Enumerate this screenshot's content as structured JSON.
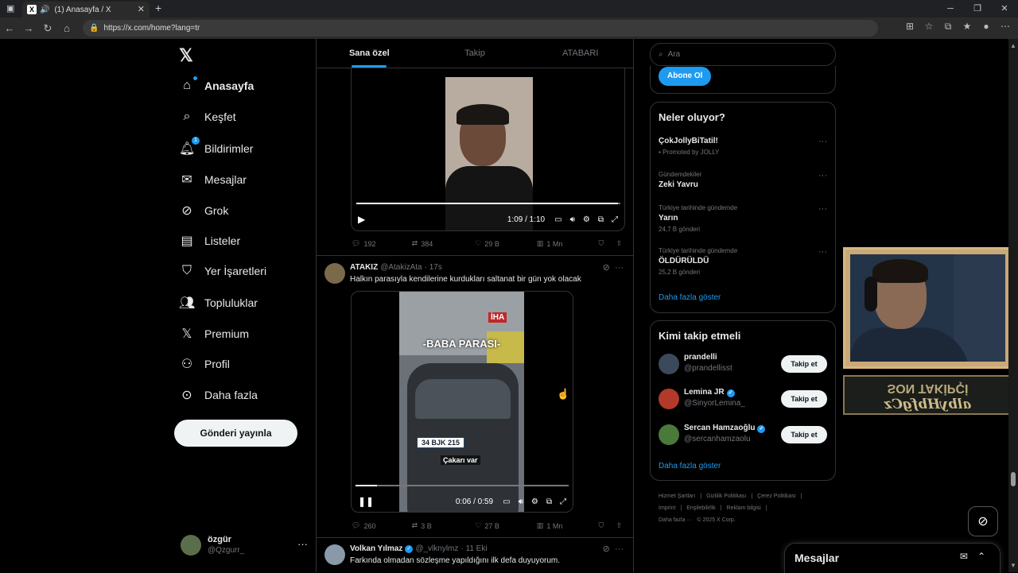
{
  "browser": {
    "tab_title": "(1) Anasayfa / X",
    "url": "https://x.com/home?lang=tr"
  },
  "nav": {
    "items": [
      {
        "label": "Anasayfa",
        "icon": "home-icon"
      },
      {
        "label": "Keşfet",
        "icon": "search-icon"
      },
      {
        "label": "Bildirimler",
        "icon": "bell-icon",
        "badge": "1"
      },
      {
        "label": "Mesajlar",
        "icon": "mail-icon"
      },
      {
        "label": "Grok",
        "icon": "grok-icon"
      },
      {
        "label": "Listeler",
        "icon": "list-icon"
      },
      {
        "label": "Yer İşaretleri",
        "icon": "bookmark-icon"
      },
      {
        "label": "Topluluklar",
        "icon": "communities-icon"
      },
      {
        "label": "Premium",
        "icon": "x-icon"
      },
      {
        "label": "Profil",
        "icon": "person-icon"
      },
      {
        "label": "Daha fazla",
        "icon": "more-circle-icon"
      }
    ],
    "post_button": "Gönderi yayınla",
    "account": {
      "name": "özgür",
      "handle": "@Qzgurr_"
    }
  },
  "tabs": [
    "Sana özel",
    "Takip",
    "ATABARI"
  ],
  "tweets": [
    {
      "video_time": "1:09 / 1:10",
      "progress": 0.99,
      "replies": "192",
      "retweets": "384",
      "likes": "29 B",
      "views": "1 Mn"
    },
    {
      "name": "ATAKIZ",
      "handle": "@AtakizAta",
      "time": "· 17s",
      "text": "Halkın parasıyla kendilerine kurdukları saltanat bir gün yok olacak",
      "video_overlay_title": "-BABA PARASI-",
      "video_caption": "Çakarı var",
      "plate": "34 BJK 215",
      "video_logo": "İHA",
      "video_time": "0:06 / 0:59",
      "progress": 0.1,
      "replies": "260",
      "retweets": "3 B",
      "likes": "27 B",
      "views": "1 Mn"
    },
    {
      "name": "Volkan Yılmaz",
      "handle": "@_vlknylmz",
      "time": "· 11 Eki",
      "text": "Farkında olmadan sözleşme yapıldığını ilk defa duyuyorum."
    }
  ],
  "right": {
    "search_placeholder": "Ara",
    "subscribe": "Abone Ol",
    "trends_title": "Neler oluyor?",
    "trends": [
      {
        "context": "",
        "title": "ÇokJollyBiTatil!",
        "count": "Promoted by JOLLY"
      },
      {
        "context": "Gündemdekiler",
        "title": "Zeki Yavru",
        "count": ""
      },
      {
        "context": "Türkiye tarihinde gündemde",
        "title": "Yarın",
        "count": "24,7 B gönderi"
      },
      {
        "context": "Türkiye tarihinde gündemde",
        "title": "ÖLDÜRÜLDÜ",
        "count": "25,2 B gönderi"
      }
    ],
    "trends_more": "Daha fazla göster",
    "who_title": "Kimi takip etmeli",
    "who": [
      {
        "name": "prandelli",
        "handle": "@prandellisst",
        "verified": false
      },
      {
        "name": "Lemina JR",
        "handle": "@SinyorLemina_",
        "verified": true
      },
      {
        "name": "Sercan Hamzaoğlu",
        "handle": "@sercanhamzaolu",
        "verified": true
      }
    ],
    "follow_label": "Takip et",
    "who_more": "Daha fazla göster",
    "footer": [
      "Hizmet Şartları",
      "|",
      "Gizlilik Politikası",
      "|",
      "Çerez Politikası",
      "|",
      "Imprint",
      "|",
      "Erişilebilirlik",
      "|",
      "Reklam bilgisi",
      "|",
      "Daha fazla ···",
      "© 2025 X Corp."
    ]
  },
  "messages_dock": "Mesajlar",
  "overlay": {
    "last_follower_title": "SON TAKİPÇİ",
    "last_follower_name": "albyHbfgCz"
  }
}
